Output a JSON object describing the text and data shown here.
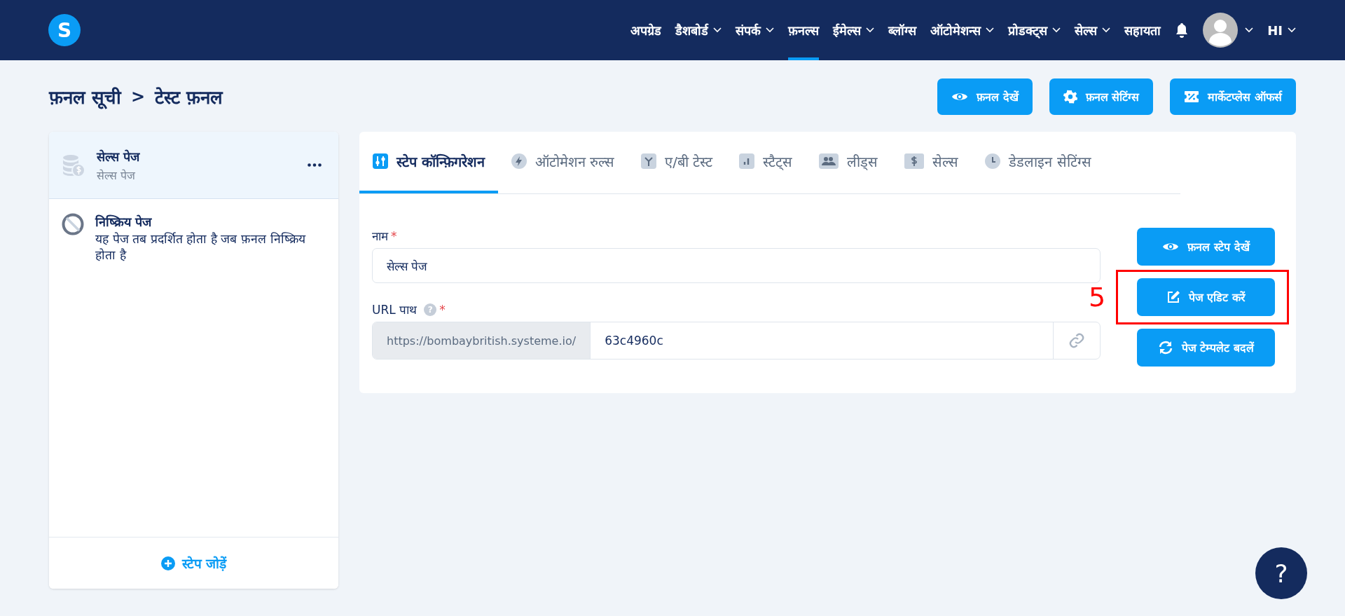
{
  "logo": "S",
  "nav": [
    {
      "label": "अपग्रेड",
      "dropdown": false,
      "selected": false
    },
    {
      "label": "डैशबोर्ड",
      "dropdown": true,
      "selected": false
    },
    {
      "label": "संपर्क",
      "dropdown": true,
      "selected": false
    },
    {
      "label": "फ़नल्स",
      "dropdown": false,
      "selected": true
    },
    {
      "label": "ईमेल्स",
      "dropdown": true,
      "selected": false
    },
    {
      "label": "ब्लॉग्स",
      "dropdown": false,
      "selected": false
    },
    {
      "label": "ऑटोमेशन्स",
      "dropdown": true,
      "selected": false
    },
    {
      "label": "प्रोडक्ट्स",
      "dropdown": true,
      "selected": false
    },
    {
      "label": "सेल्स",
      "dropdown": true,
      "selected": false
    },
    {
      "label": "सहायता",
      "dropdown": false,
      "selected": false
    }
  ],
  "language": "HI",
  "breadcrumb": [
    {
      "label": "फ़नल सूची"
    },
    {
      "label": "टेस्ट फ़नल"
    }
  ],
  "breadcrumb_separator": ">",
  "header_buttons": [
    {
      "label": "फ़नल देखें",
      "kind": "eye"
    },
    {
      "label": "फ़नल सेटिंग्स",
      "kind": "gear"
    },
    {
      "label": "मार्केटप्लेस ऑफर्स",
      "kind": "offer"
    }
  ],
  "steps": [
    {
      "kind": "step",
      "title": "सेल्स पेज",
      "subtitle": "सेल्स पेज",
      "selected": true
    },
    {
      "kind": "inactive",
      "title": "निष्क्रिय पेज",
      "description": "यह पेज तब प्रदर्शित होता है जब फ़नल निष्क्रिय होता है",
      "selected": false
    }
  ],
  "add_step": "स्टेप जोड़ें",
  "tabs": [
    {
      "label": "स्टेप कॉन्फ़िगरेशन",
      "selected": true
    },
    {
      "label": "ऑटोमेशन रुल्स",
      "selected": false
    },
    {
      "label": "ए/बी टेस्ट",
      "selected": false
    },
    {
      "label": "स्टैट्स",
      "selected": false
    },
    {
      "label": "लीड्स",
      "selected": false
    },
    {
      "label": "सेल्स",
      "selected": false
    },
    {
      "label": "डेडलाइन सेटिंग्स",
      "selected": false
    }
  ],
  "name_field": {
    "label": "नाम",
    "required_mark": "*",
    "value": "सेल्स पेज"
  },
  "url_field": {
    "label": "URL पाथ",
    "required_mark": "*",
    "help": "?",
    "prefix": "https://bombaybritish.systeme.io/",
    "value": "63c4960c"
  },
  "side_buttons": [
    {
      "label": "फ़नल स्टेप देखें",
      "kind": "eye",
      "highlighted": false
    },
    {
      "label": "पेज एडिट करें",
      "kind": "edit",
      "highlighted": true
    },
    {
      "label": "पेज टेम्पलेट बदलें",
      "kind": "refresh",
      "highlighted": false
    }
  ],
  "annotation": {
    "label": "5"
  },
  "help_button": "?"
}
